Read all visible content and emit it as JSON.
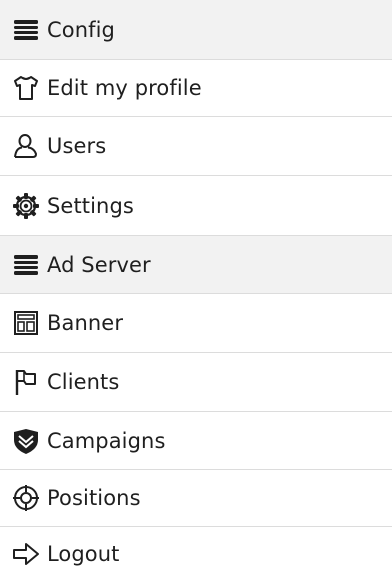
{
  "menu": {
    "items": [
      {
        "label": "Config",
        "icon": "stack-icon",
        "section_header": true
      },
      {
        "label": "Edit my profile",
        "icon": "tshirt-icon",
        "section_header": false
      },
      {
        "label": "Users",
        "icon": "user-icon",
        "section_header": false
      },
      {
        "label": "Settings",
        "icon": "gear-icon",
        "section_header": false
      },
      {
        "label": "Ad Server",
        "icon": "stack-icon",
        "section_header": true
      },
      {
        "label": "Banner",
        "icon": "layout-icon",
        "section_header": false
      },
      {
        "label": "Clients",
        "icon": "flag-icon",
        "section_header": false
      },
      {
        "label": "Campaigns",
        "icon": "shield-icon",
        "section_header": false
      },
      {
        "label": "Positions",
        "icon": "crosshair-icon",
        "section_header": false
      },
      {
        "label": "Logout",
        "icon": "arrow-right-icon",
        "section_header": false
      }
    ]
  },
  "colors": {
    "header_bg": "#f2f2f2",
    "row_bg": "#ffffff",
    "divider": "#dcdcdc",
    "text": "#1f1f1f"
  }
}
